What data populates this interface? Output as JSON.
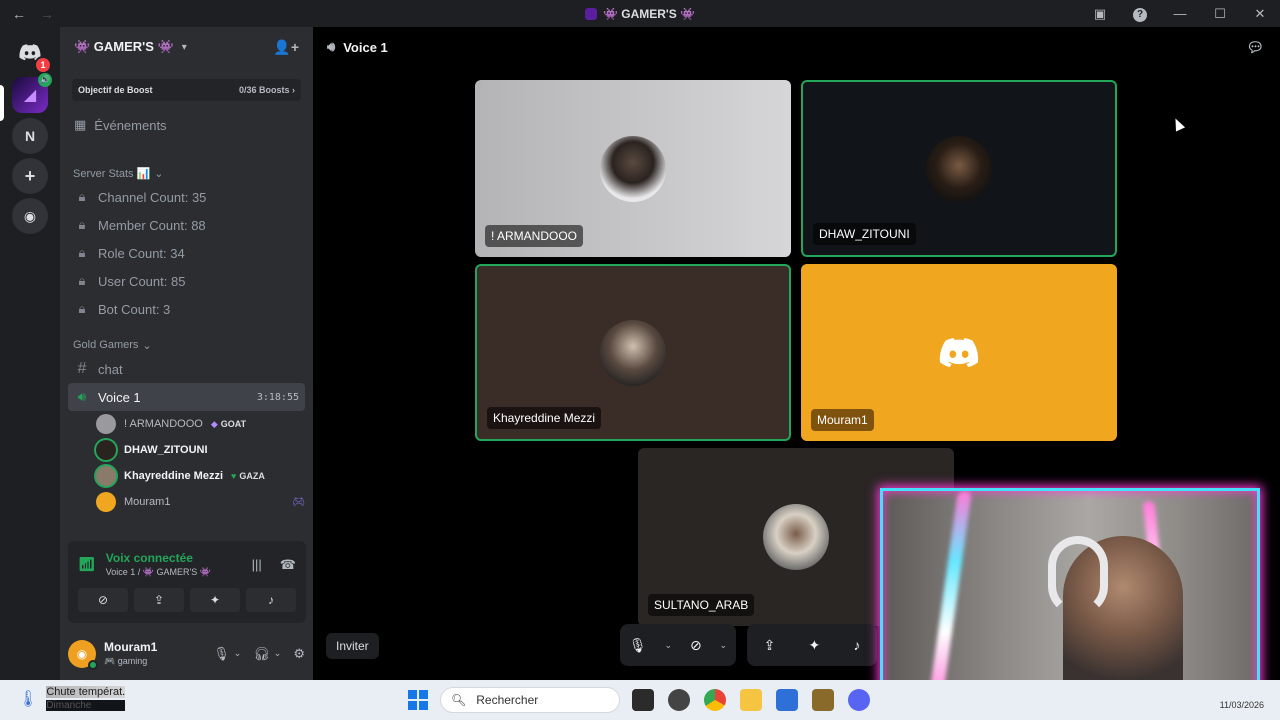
{
  "window": {
    "title": "👾 GAMER'S 👾",
    "back_icon": "arrow-left-icon",
    "forward_icon": "arrow-right-icon"
  },
  "guilds": {
    "home_badge": "1",
    "n_label": "N"
  },
  "server": {
    "name": "👾 GAMER'S 👾",
    "boost_label": "Objectif de Boost",
    "boost_count": "0/36 Boosts",
    "events_label": "Événements",
    "stats_category": "Server Stats 📊",
    "stats_channels": [
      "Channel Count: 35",
      "Member Count: 88",
      "Role Count: 34",
      "User Count: 85",
      "Bot Count: 3"
    ],
    "gold_category": "Gold Gamers",
    "chat_channel": "chat",
    "voice_channel": "Voice 1",
    "voice_timer": "3:18:55",
    "voice_users": [
      {
        "name": "! ARMANDOOO",
        "tag": "GOAT"
      },
      {
        "name": "DHAW_ZITOUNI"
      },
      {
        "name": "Khayreddine Mezzi",
        "tag": "GAZA"
      },
      {
        "name": "Mouram1"
      }
    ]
  },
  "voice_panel": {
    "status": "Voix connectée",
    "location": "Voice 1 / 👾 GAMER'S 👾"
  },
  "user": {
    "name": "Mouram1",
    "status": "🎮 gaming"
  },
  "main": {
    "header": "Voice 1",
    "tiles": [
      {
        "name": "! ARMANDOOO"
      },
      {
        "name": "DHAW_ZITOUNI"
      },
      {
        "name": "Khayreddine Mezzi"
      },
      {
        "name": "Mouram1"
      },
      {
        "name": "SULTANO_ARAB"
      }
    ],
    "invite_label": "Inviter"
  },
  "taskbar": {
    "weather_title": "Chute températ.",
    "weather_sub": "Dimanche",
    "search_placeholder": "Rechercher",
    "date": "11/03/2026"
  },
  "colors": {
    "accent_green": "#23a55a",
    "discord_orange": "#f0a71f",
    "cam_border": "#45e0ff"
  }
}
